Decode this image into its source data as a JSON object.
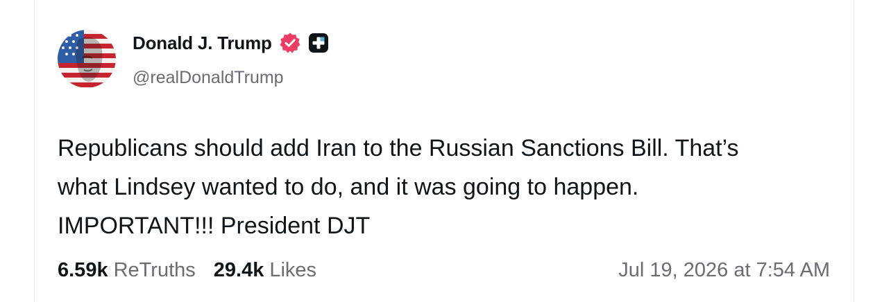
{
  "post": {
    "author": {
      "display_name": "Donald J. Trump",
      "handle": "@realDonaldTrump",
      "verified_badge_color": "#ec3e64",
      "avatar_icon": "avatar-flag-portrait"
    },
    "body_lines": [
      "Republicans should add Iran to the Russian Sanctions Bill. That’s",
      "what Lindsey wanted to do, and it was going to happen.",
      "IMPORTANT!!! President DJT"
    ],
    "stats": {
      "retruths_count": "6.59k",
      "retruths_label": "ReTruths",
      "likes_count": "29.4k",
      "likes_label": "Likes"
    },
    "timestamp": "Jul 19, 2026 at 7:54 AM"
  }
}
